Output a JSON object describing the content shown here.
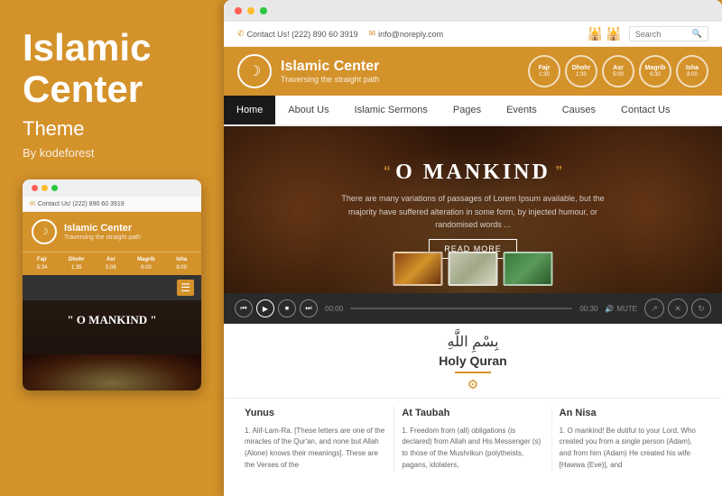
{
  "left": {
    "title": "Islamic Center",
    "subtitle": "Theme",
    "by": "By kodeforest",
    "logo_char": "☽"
  },
  "browser": {
    "contact_phone": "Contact Us! (222) 890 60 3919",
    "contact_email": "info@noreply.com",
    "search_placeholder": "Search",
    "site_name": "Islamic Center",
    "site_tagline": "Traversing the straight path",
    "prayer_times": [
      {
        "name": "Fajr",
        "time": "1:30"
      },
      {
        "name": "Dhohr",
        "time": "1:30"
      },
      {
        "name": "Asr",
        "time": "5:00"
      },
      {
        "name": "Magrib",
        "time": "6:30"
      },
      {
        "name": "Isha",
        "time": "8:00"
      }
    ],
    "nav_items": [
      "Home",
      "About Us",
      "Islamic Sermons",
      "Pages",
      "Events",
      "Causes",
      "Contact Us"
    ],
    "nav_active": "Home",
    "hero": {
      "quote_open": "“",
      "title": "O MANKIND",
      "quote_close": "”",
      "description": "There are many variations of passages of Lorem Ipsum available, but the majority have suffered alteration in some form, by injected humour, or randomised words ...",
      "button_label": "READ MORE"
    },
    "audio": {
      "start_time": "00:00",
      "end_time": "00:30",
      "mute_label": "MUTE"
    },
    "quran": {
      "arabic": "بِسْمِ اللَّهِ",
      "title": "Holy Quran",
      "icon": "⚙"
    },
    "surahs": [
      {
        "name": "Yunus",
        "text": "1. Alif-Lam-Ra. [These letters are one of the miracles of the Qur'an, and none but Allah (Alone) knows their meanings]. These are the Verses of the"
      },
      {
        "name": "At Taubah",
        "text": "1. Freedom from (all) obligations (is declared) from Allah and His Messenger (s) to those of the Mushrikun (polytheists, pagans, idolaters,"
      },
      {
        "name": "An Nisa",
        "text": "1. O mankind! Be dutiful to your Lord, Who created you from a single person (Adam), and from him (Adam) He created his wife [Hawwa (Eve)], and"
      }
    ]
  },
  "mobile": {
    "contact": "Contact Us! (222) 890 60 3919",
    "site_name": "Islamic Center",
    "site_tagline": "Traversing the straight path",
    "prayer_times": [
      {
        "name": "Fajr",
        "time": "5:34"
      },
      {
        "name": "Dhohr",
        "time": "1:35"
      },
      {
        "name": "Asr",
        "time": "5:08"
      },
      {
        "name": "Magrib",
        "time": "6:00"
      },
      {
        "name": "Isha",
        "time": "8:00"
      }
    ],
    "hero_title": "\" O MANKIND \""
  }
}
